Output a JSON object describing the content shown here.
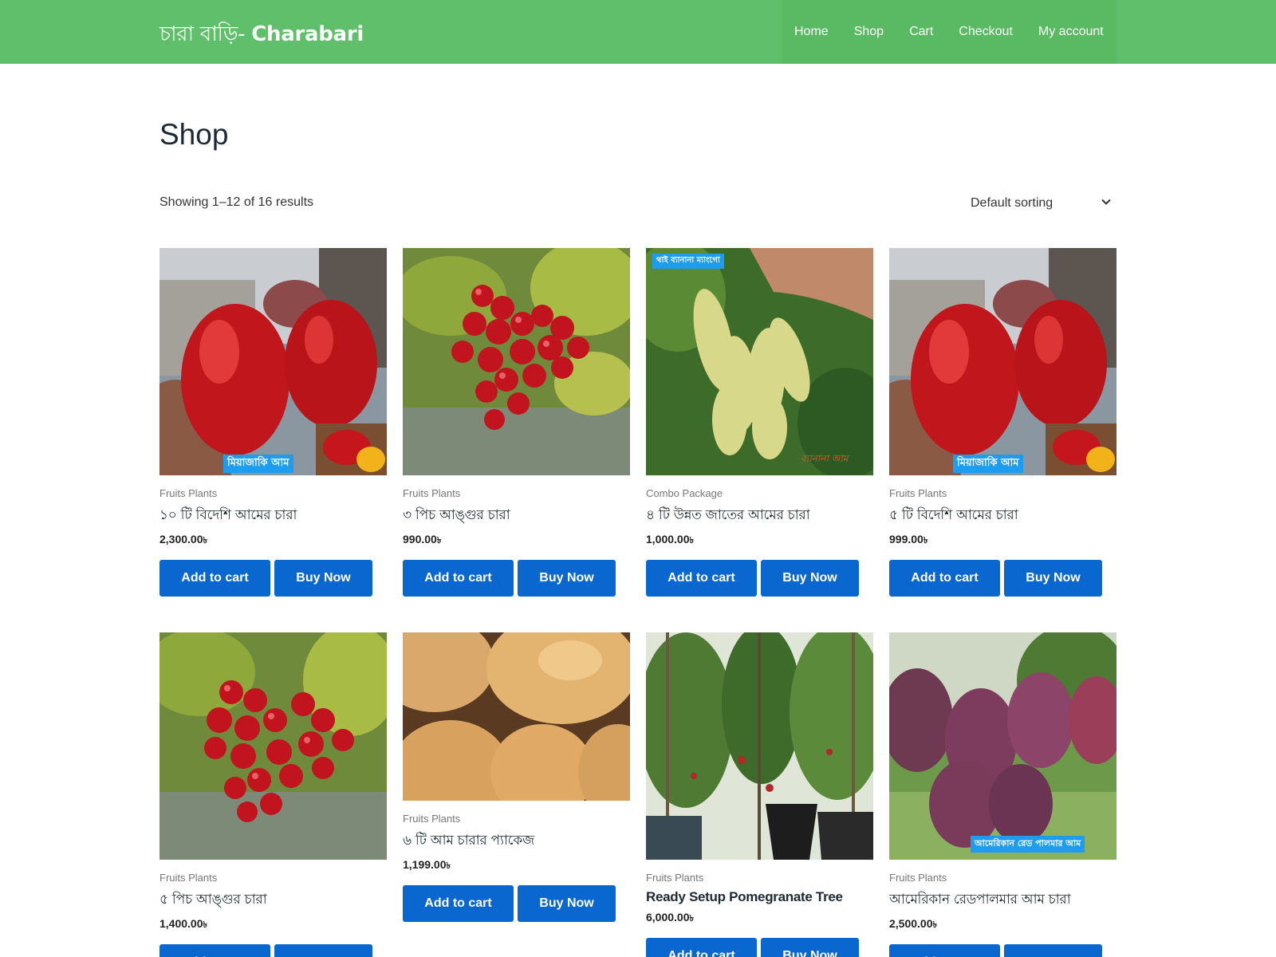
{
  "header": {
    "site_title_bn": "চারা বাড়ি- ",
    "site_title_en": "Charabari",
    "nav": [
      "Home",
      "Shop",
      "Cart",
      "Checkout",
      "My account"
    ]
  },
  "page": {
    "title": "Shop",
    "result_count": "Showing 1–12 of 16 results",
    "sorting": "Default sorting"
  },
  "colors": {
    "header": "#5fbf6a",
    "button": "#0b67d0"
  },
  "currency": "৳",
  "buttons": {
    "add_to_cart": "Add to cart",
    "buy_now": "Buy Now"
  },
  "products": [
    {
      "category": "Fruits Plants",
      "name": "১০ টি বিদেশি আমের চারা",
      "price": "2,300.00",
      "image_label": "মিয়াজাকি আম"
    },
    {
      "category": "Fruits Plants",
      "name": "৩ পিচ আঙ্গুর চারা",
      "price": "990.00"
    },
    {
      "category": "Combo Package",
      "name": "৪ টি উন্নত জাতের আমের চারা",
      "price": "1,000.00",
      "image_label": "থাই ব্যানানা ম্যাংগো",
      "image_label_2": "ব্যানানা আম"
    },
    {
      "category": "Fruits Plants",
      "name": "৫ টি বিদেশি আমের চারা",
      "price": "999.00",
      "image_label": "মিয়াজাকি আম"
    },
    {
      "category": "Fruits Plants",
      "name": "৫ পিচ আঙ্গুর চারা",
      "price": "1,400.00"
    },
    {
      "category": "Fruits Plants",
      "name": "৬ টি আম চারার প্যাকেজ",
      "price": "1,199.00"
    },
    {
      "category": "Fruits Plants",
      "name": "Ready Setup Pomegranate Tree",
      "price": "6,000.00"
    },
    {
      "category": "Fruits Plants",
      "name": "আমেরিকান রেডপালমার আম চারা",
      "price": "2,500.00",
      "image_label": "আমেরিকান রেড পালমার আম"
    }
  ]
}
